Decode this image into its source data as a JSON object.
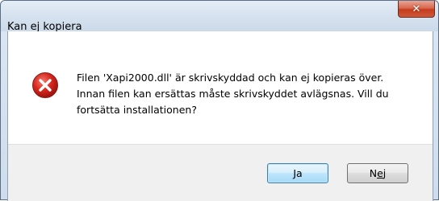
{
  "window": {
    "title": "Kan ej kopiera",
    "close_glyph": "✕"
  },
  "dialog": {
    "icon": "error-icon",
    "message_lines": [
      "Filen 'Xapi2000.dll' är skrivskyddad och kan ej kopieras över.",
      "Innan filen kan ersättas måste skrivskyddet avlägsnas. Vill du",
      "fortsätta installationen?"
    ]
  },
  "buttons": {
    "yes_label": "Ja",
    "no_label_pre": "N",
    "no_label_accel": "e",
    "no_label_post": "j"
  },
  "colors": {
    "error_red": "#d7281f",
    "close_red": "#c43b1c",
    "default_button_border": "#3c7fb1"
  }
}
